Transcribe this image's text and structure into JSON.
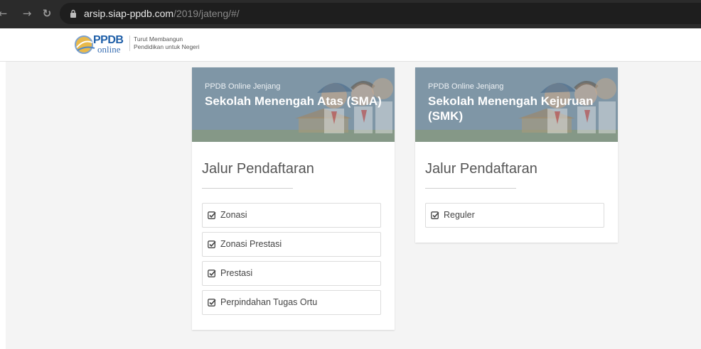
{
  "browser": {
    "url_host": "arsip.siap-ppdb.com",
    "url_path": "/2019/jateng/#/"
  },
  "header": {
    "logo_ppdb": "PPDB",
    "logo_online": "online",
    "tagline_1": "Turut Membangun",
    "tagline_2": "Pendidikan untuk Negeri"
  },
  "cards": [
    {
      "subtitle": "PPDB Online Jenjang",
      "title": "Sekolah Menengah Atas (SMA)",
      "section": "Jalur Pendaftaran",
      "options": [
        "Zonasi",
        "Zonasi Prestasi",
        "Prestasi",
        "Perpindahan Tugas Ortu"
      ]
    },
    {
      "subtitle": "PPDB Online Jenjang",
      "title": "Sekolah Menengah Kejuruan (SMK)",
      "section": "Jalur Pendaftaran",
      "options": [
        "Reguler"
      ]
    }
  ],
  "colors": {
    "banner": "#7f96a6",
    "browser_bar": "#2b2b2b",
    "page_bg": "#f4f4f4"
  }
}
